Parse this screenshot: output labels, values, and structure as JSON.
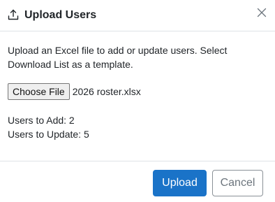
{
  "dialog": {
    "title": "Upload Users",
    "title_icon": "upload-icon",
    "close_icon": "close-icon"
  },
  "body": {
    "description": "Upload an Excel file to add or update users. Select Download List as a template.",
    "file_input": {
      "button_label": "Choose File",
      "file_name": "2026 roster.xlsx"
    },
    "users_to_add": "Users to Add: 2",
    "users_to_update": "Users to Update: 5"
  },
  "footer": {
    "upload_label": "Upload",
    "cancel_label": "Cancel"
  },
  "colors": {
    "primary": "#1a73c8",
    "border": "#dee2e6",
    "text": "#212529",
    "muted": "#6c757d"
  }
}
